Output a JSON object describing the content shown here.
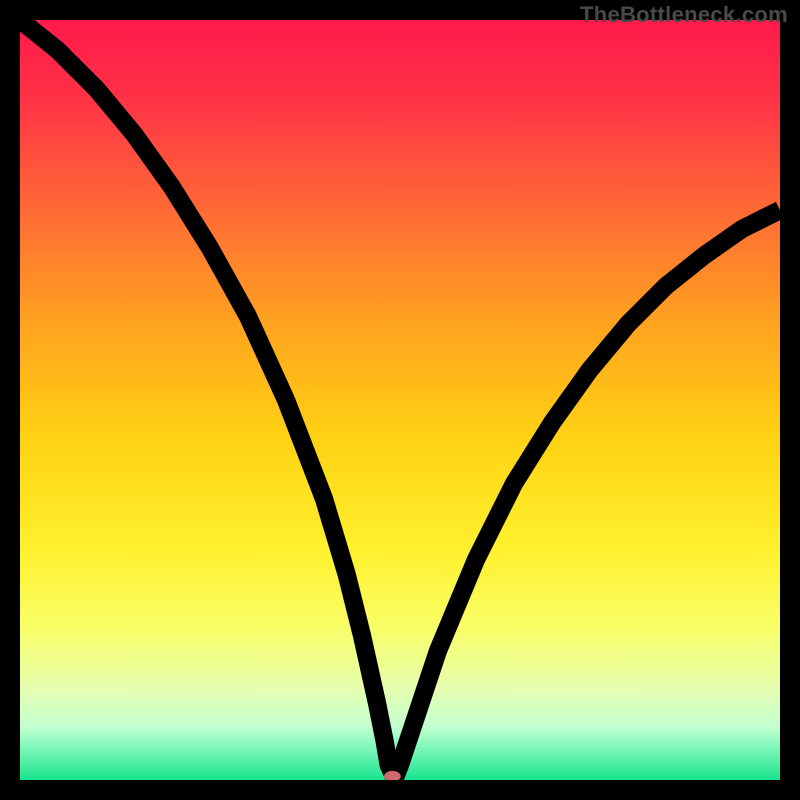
{
  "watermark": "TheBottleneck.com",
  "chart_data": {
    "type": "line",
    "title": "",
    "xlabel": "",
    "ylabel": "",
    "xlim": [
      0,
      100
    ],
    "ylim": [
      0,
      100
    ],
    "grid": false,
    "legend": false,
    "series": [
      {
        "name": "curve",
        "x": [
          0,
          5,
          10,
          15,
          20,
          25,
          30,
          35,
          40,
          43,
          45,
          47,
          48,
          48.5,
          49.3,
          50,
          52,
          55,
          60,
          65,
          70,
          75,
          80,
          85,
          90,
          95,
          100
        ],
        "values": [
          100,
          96,
          91,
          85,
          78,
          70,
          61,
          50,
          37,
          27,
          19,
          10,
          5,
          2,
          0.2,
          2,
          8,
          17,
          29,
          39,
          47,
          54,
          60,
          65,
          69,
          72.5,
          75
        ]
      }
    ],
    "marker": {
      "x": 49,
      "y": 0.5,
      "color": "#cf6a6f"
    },
    "background_gradient": {
      "stops": [
        {
          "offset": 0.0,
          "color": "#ff1a4b"
        },
        {
          "offset": 0.1,
          "color": "#ff3146"
        },
        {
          "offset": 0.25,
          "color": "#ff6a36"
        },
        {
          "offset": 0.4,
          "color": "#ffa31f"
        },
        {
          "offset": 0.55,
          "color": "#ffd213"
        },
        {
          "offset": 0.7,
          "color": "#fff12e"
        },
        {
          "offset": 0.8,
          "color": "#f9ff68"
        },
        {
          "offset": 0.88,
          "color": "#e6ffb0"
        },
        {
          "offset": 0.93,
          "color": "#c2ffd0"
        },
        {
          "offset": 0.965,
          "color": "#6cf5b4"
        },
        {
          "offset": 1.0,
          "color": "#18e48e"
        }
      ]
    }
  }
}
